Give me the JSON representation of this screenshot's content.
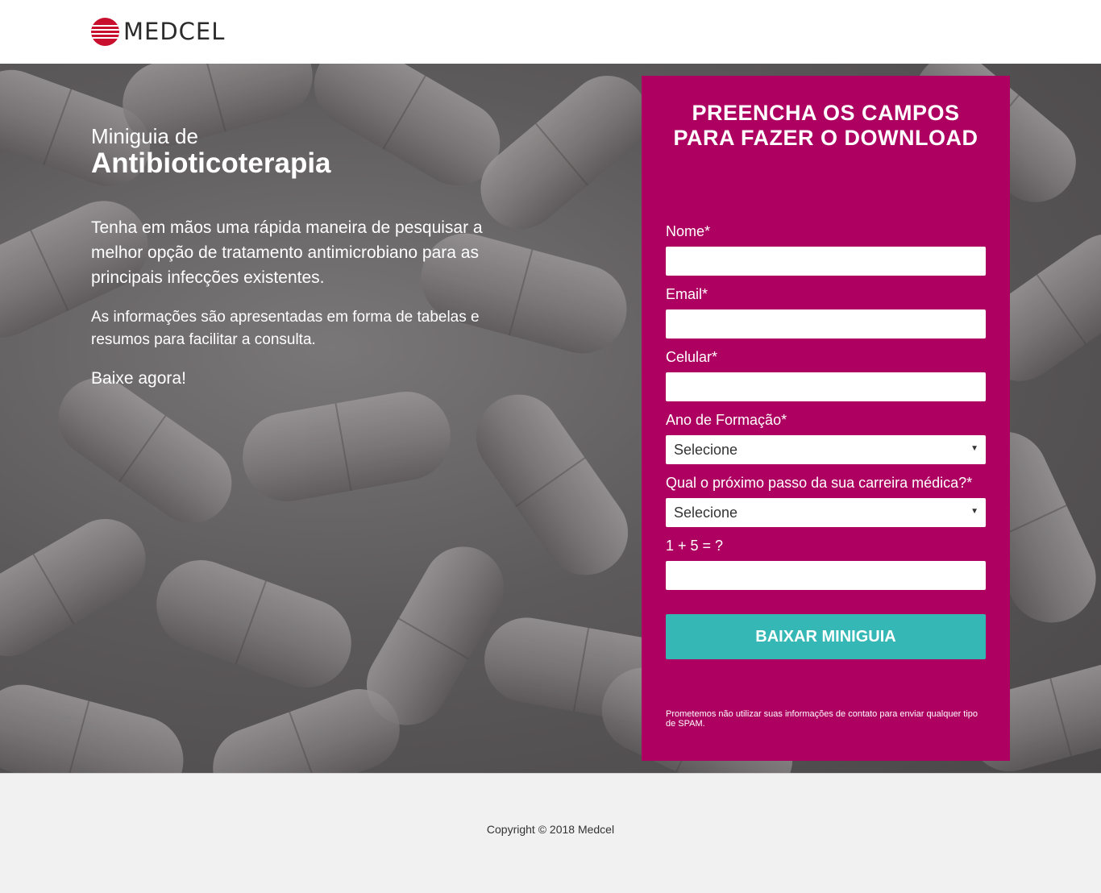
{
  "brand": {
    "name": "MEDCEL",
    "logo_icon": "medcel-logo-icon",
    "accent_color": "#c8102e"
  },
  "hero": {
    "subtitle": "Miniguia de",
    "title": "Antibioticoterapia",
    "paragraph1": "Tenha em mãos uma rápida maneira de pesquisar a melhor opção de tratamento antimicrobiano para as principais infecções existentes.",
    "paragraph2": "As informações são apresentadas em forma de tabelas e resumos para facilitar a consulta.",
    "paragraph3": "Baixe agora!"
  },
  "form": {
    "title_line1": "PREENCHA OS CAMPOS",
    "title_line2": "PARA FAZER O DOWNLOAD",
    "background_color": "#ad0060",
    "fields": {
      "name_label": "Nome*",
      "email_label": "Email*",
      "phone_label": "Celular*",
      "year_label": "Ano de Formação*",
      "year_value": "Selecione",
      "career_label": "Qual o próximo passo da sua carreira médica?*",
      "career_value": "Selecione",
      "captcha_label": "1 + 5 = ?"
    },
    "submit_label": "BAIXAR MINIGUIA",
    "submit_color": "#35b8b5",
    "disclaimer": "Prometemos não utilizar suas informações de contato para enviar qualquer tipo de SPAM."
  },
  "footer": {
    "copyright": "Copyright © 2018 Medcel"
  }
}
